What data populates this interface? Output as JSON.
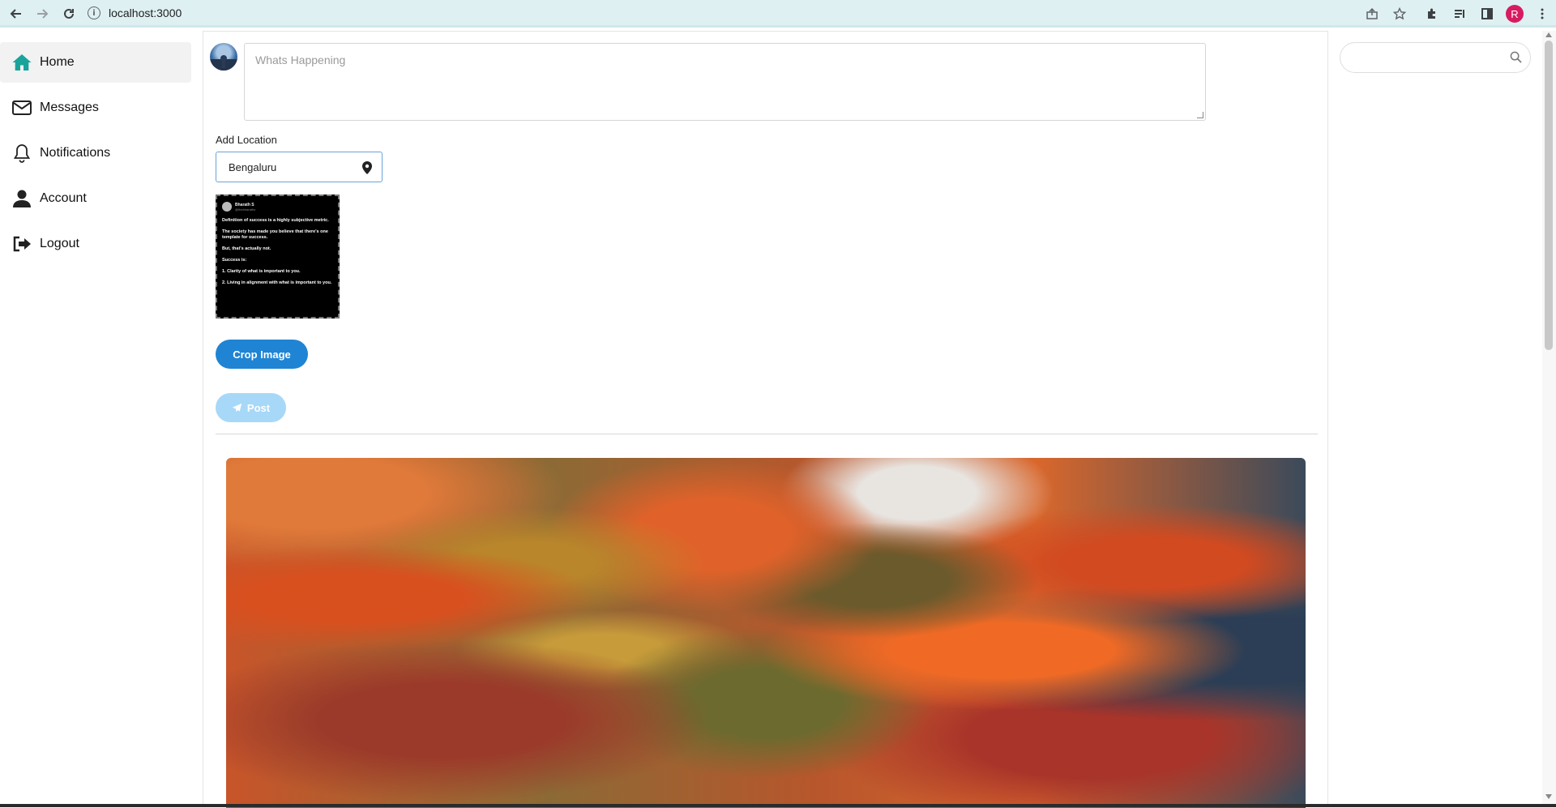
{
  "browser": {
    "url": "localhost:3000",
    "profile_initial": "R"
  },
  "sidebar": {
    "items": [
      {
        "label": "Home",
        "icon": "home-icon",
        "active": true
      },
      {
        "label": "Messages",
        "icon": "envelope-icon"
      },
      {
        "label": "Notifications",
        "icon": "bell-icon"
      },
      {
        "label": "Account",
        "icon": "user-icon"
      },
      {
        "label": "Logout",
        "icon": "sign-out-icon"
      }
    ]
  },
  "composer": {
    "placeholder": "Whats Happening",
    "location_label": "Add Location",
    "location_value": "Bengaluru",
    "crop_button": "Crop Image",
    "post_button": "Post"
  },
  "preview": {
    "name": "Bharath S",
    "handle": "@thebharaths",
    "lines": [
      "Definition of success is a highly subjective metric.",
      "The society has made you believe that there's one template for success.",
      "But, that's actually not.",
      "Success is:",
      "1. Clarity of what is important to you.",
      "2. Living in alignment with what is important to you."
    ]
  },
  "colors": {
    "accent": "#1f84d3",
    "post_disabled": "#a7d8f7",
    "home_icon": "#1aa39a"
  }
}
